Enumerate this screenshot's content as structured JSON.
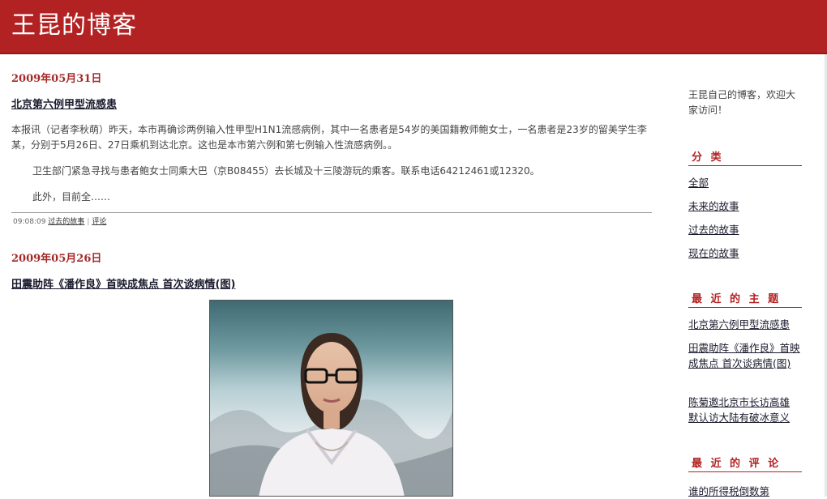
{
  "blog": {
    "title": "王昆的博客"
  },
  "posts": [
    {
      "date": "2009年05月31日",
      "title": "北京第六例甲型流感患",
      "paragraphs": [
        "本报讯（记者李秋萌）昨天，本市再确诊两例输入性甲型H1N1流感病例，其中一名患者是54岁的美国籍教师鲍女士，一名患者是23岁的留美学生李某，分别于5月26日、27日乘机到达北京。这也是本市第六例和第七例输入性流感病例。。",
        "卫生部门紧急寻找与患者鲍女士同乘大巴（京B08455）去长城及十三陵游玩的乘客。联系电话64212461或12320。",
        "此外，目前全……"
      ],
      "time": "09:08:09",
      "category": "过去的故事",
      "comment_label": "评论"
    },
    {
      "date": "2009年05月26日",
      "title": "田震助阵《潘作良》首映成焦点 首次谈病情(图)"
    }
  ],
  "sidebar": {
    "intro": "王昆自己的博客，欢迎大家访问！",
    "categories_heading": "分 类",
    "categories": [
      "全部",
      "未来的故事",
      "过去的故事",
      "现在的故事"
    ],
    "recent_heading": "最 近 的 主 题",
    "recent_posts": [
      "北京第六例甲型流感患",
      "田震助阵《潘作良》首映成焦点 首次谈病情(图)",
      "陈菊邀北京市长访高雄 默认访大陆有破冰意义"
    ],
    "comments_heading": "最 近 的 评 论",
    "recent_comments": [
      "谁的所得税倒数第"
    ]
  },
  "colors": {
    "banner": "#b22222",
    "accent": "#a52a2a"
  }
}
